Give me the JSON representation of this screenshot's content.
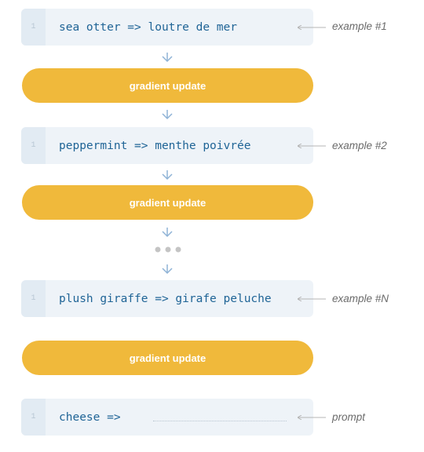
{
  "steps": [
    {
      "line_number": "1",
      "code": "sea otter => loutre de mer",
      "label": "example #1"
    },
    {
      "line_number": "1",
      "code": "peppermint => menthe poivrée",
      "label": "example #2"
    },
    {
      "line_number": "1",
      "code": "plush giraffe => girafe peluche",
      "label": "example #N"
    },
    {
      "line_number": "1",
      "code": "cheese =>",
      "label": "prompt"
    }
  ],
  "update_label": "gradient update",
  "colors": {
    "code_background": "#eef3f8",
    "code_text": "#1f6496",
    "pill": "#f0b93b",
    "arrow": "#8fb3d6"
  },
  "icons": [
    "arrow-down-icon",
    "ellipsis-icon",
    "pointer-line-icon"
  ]
}
